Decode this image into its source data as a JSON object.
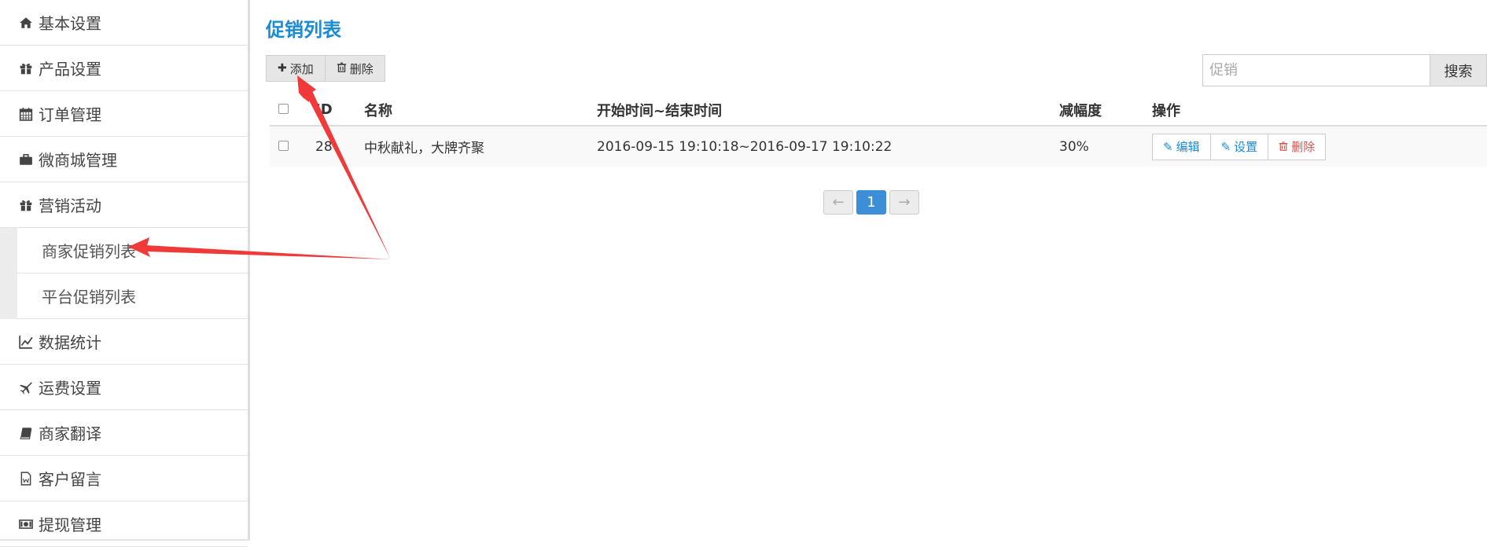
{
  "sidebar": {
    "items": [
      {
        "label": "基本设置",
        "icon": "home-icon"
      },
      {
        "label": "产品设置",
        "icon": "gift-icon"
      },
      {
        "label": "订单管理",
        "icon": "calendar-icon"
      },
      {
        "label": "微商城管理",
        "icon": "briefcase-icon"
      },
      {
        "label": "营销活动",
        "icon": "gift-icon"
      }
    ],
    "sub_items": [
      {
        "label": "商家促销列表"
      },
      {
        "label": "平台促销列表"
      }
    ],
    "items_after": [
      {
        "label": "数据统计",
        "icon": "line-chart-icon"
      },
      {
        "label": "运费设置",
        "icon": "plane-icon"
      },
      {
        "label": "商家翻译",
        "icon": "book-icon"
      },
      {
        "label": "客户留言",
        "icon": "document-icon"
      },
      {
        "label": "提现管理",
        "icon": "money-icon"
      }
    ]
  },
  "main": {
    "title": "促销列表",
    "toolbar": {
      "add_label": "添加",
      "delete_label": "删除"
    },
    "search": {
      "placeholder": "促销",
      "button_label": "搜索"
    },
    "table": {
      "headers": [
        "ID",
        "名称",
        "开始时间~结束时间",
        "减幅度",
        "操作"
      ],
      "rows": [
        {
          "id": "28",
          "name": "中秋献礼，大牌齐聚",
          "time": "2016-09-15 19:10:18~2016-09-17 19:10:22",
          "discount": "30%",
          "actions": {
            "edit": "编辑",
            "settings": "设置",
            "delete": "删除"
          }
        }
      ]
    },
    "pagination": {
      "prev": "←",
      "current": "1",
      "next": "→"
    }
  },
  "colors": {
    "accent": "#1a8bd8",
    "danger": "#d9534f",
    "annotation": "#f03a3a",
    "pager_active": "#3c8ed6"
  }
}
